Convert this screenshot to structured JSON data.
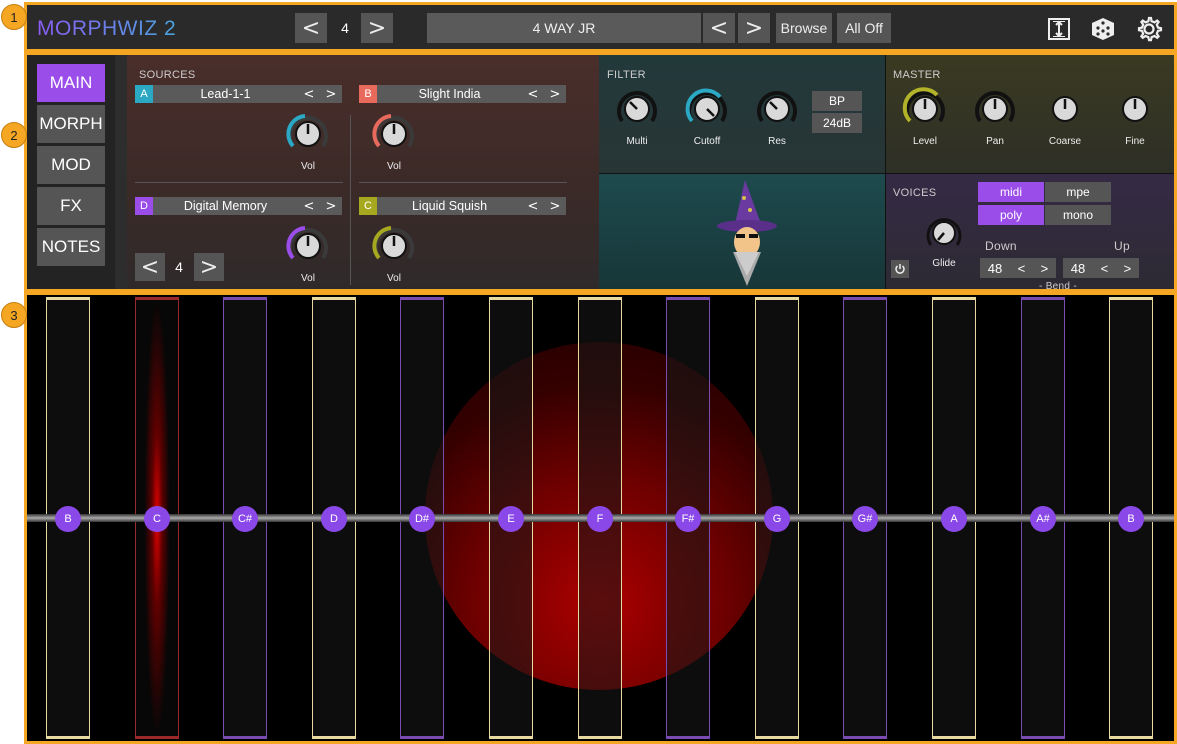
{
  "callouts": [
    "1",
    "2",
    "3"
  ],
  "header": {
    "logo": "MORPHWIZ 2",
    "octave_prev": "<",
    "octave_value": "4",
    "octave_next": ">",
    "preset_name": "4 WAY JR",
    "preset_prev": "<",
    "preset_next": ">",
    "browse_label": "Browse",
    "all_off_label": "All Off",
    "icons": [
      "fit-height-icon",
      "dice-icon",
      "gear-icon"
    ]
  },
  "nav": {
    "items": [
      "MAIN",
      "MORPH",
      "MOD",
      "FX",
      "NOTES"
    ],
    "active": "MAIN"
  },
  "sources": {
    "label": "SOURCES",
    "items": [
      {
        "letter": "A",
        "name": "Lead-1-1",
        "color": "#2aa8c4",
        "knob": "Vol"
      },
      {
        "letter": "B",
        "name": "Slight India",
        "color": "#e86a5c",
        "knob": "Vol"
      },
      {
        "letter": "D",
        "name": "Digital Memory",
        "color": "#9b4dea",
        "knob": "Vol"
      },
      {
        "letter": "C",
        "name": "Liquid Squish",
        "color": "#a6a820",
        "knob": "Vol"
      }
    ],
    "arrow_prev": "<",
    "arrow_next": ">",
    "stepper_prev": "<",
    "stepper_value": "4",
    "stepper_next": ">"
  },
  "filter": {
    "label": "FILTER",
    "knobs": [
      "Multi",
      "Cutoff",
      "Res"
    ],
    "type_button": "BP",
    "slope_button": "24dB"
  },
  "master": {
    "label": "MASTER",
    "knobs": [
      "Level",
      "Pan",
      "Coarse",
      "Fine"
    ]
  },
  "voices": {
    "label": "VOICES",
    "midi": "midi",
    "mpe": "mpe",
    "poly": "poly",
    "mono": "mono",
    "glide_label": "Glide",
    "down_label": "Down",
    "up_label": "Up",
    "down_value": "48",
    "up_value": "48",
    "bend_label": "- Bend -",
    "arrow_prev": "<",
    "arrow_next": ">"
  },
  "keyboard": {
    "notes": [
      "B",
      "C",
      "C#",
      "D",
      "D#",
      "E",
      "F",
      "F#",
      "G",
      "G#",
      "A",
      "A#",
      "B"
    ],
    "key_colors": [
      "#e8d9a0",
      "#9a2a2a",
      "#7a4bb0",
      "#e8d9a0",
      "#7a4bb0",
      "#e8d9a0",
      "#e8d9a0",
      "#7a4bb0",
      "#e8d9a0",
      "#7a4bb0",
      "#e8d9a0",
      "#7a4bb0",
      "#e8d9a0"
    ]
  }
}
